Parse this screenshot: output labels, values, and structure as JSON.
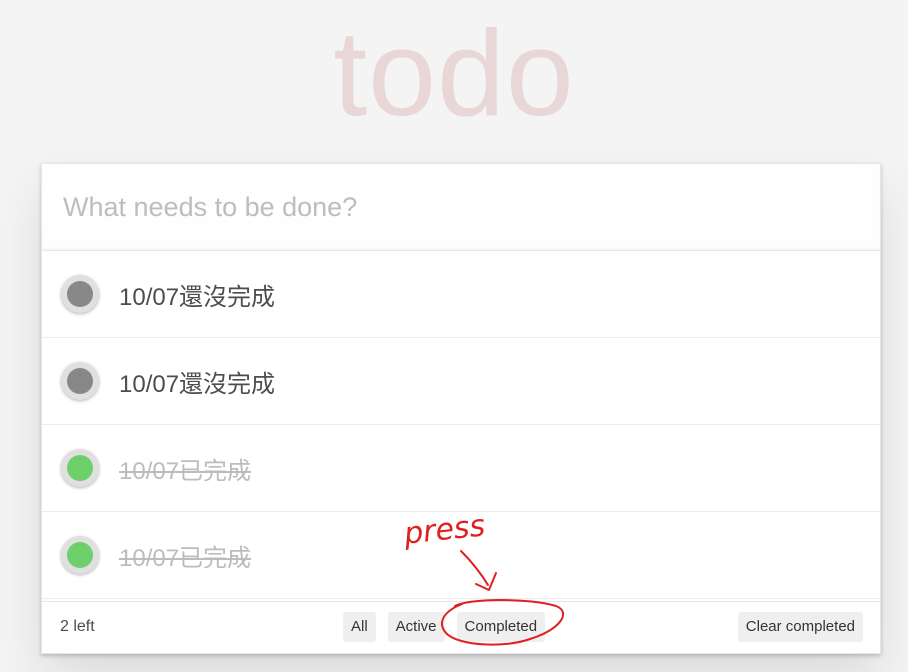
{
  "app": {
    "title": "todo"
  },
  "new_todo": {
    "placeholder": "What needs to be done?"
  },
  "todos": [
    {
      "label": "10/07還沒完成",
      "completed": false
    },
    {
      "label": "10/07還沒完成",
      "completed": false
    },
    {
      "label": "10/07已完成",
      "completed": true
    },
    {
      "label": "10/07已完成",
      "completed": true
    }
  ],
  "footer": {
    "count_text": "2 left",
    "filters": [
      "All",
      "Active",
      "Completed"
    ],
    "clear_label": "Clear completed"
  },
  "annotation": {
    "text": "press",
    "color": "#e02020"
  },
  "colors": {
    "title": "#ead7d7",
    "toggle_incomplete": "#888888",
    "toggle_complete": "#6dd06a",
    "background": "#f4f4f4"
  }
}
